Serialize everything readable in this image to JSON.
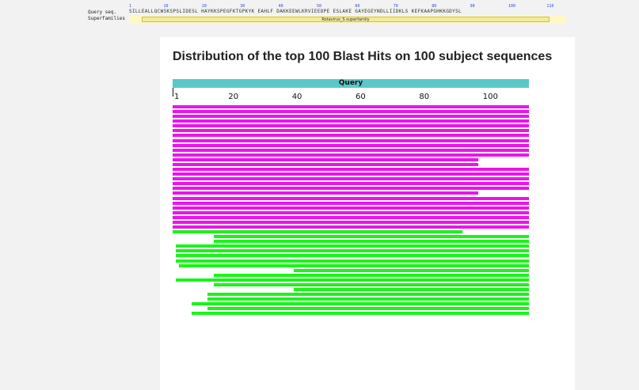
{
  "domain_strip": {
    "query_label": "Query seq.",
    "superfamilies_label": "Superfamilies",
    "ticks": [
      "1",
      "10",
      "20",
      "30",
      "40",
      "50",
      "60",
      "70",
      "80",
      "90",
      "100",
      "110"
    ],
    "sequence": "SILLEALLQCWSKSPSLIDESL HAYKKSPEGFKTGPKYK EAHLF DAKKEEWLKRVIEEDPE ESLAKE GAYEGEYNDLLIIDKLS KEFKAAPGHKKGDYSL",
    "superfamily_name": "Rotavirus_S superfamily"
  },
  "panel": {
    "title": "Distribution of the top 100 Blast Hits on 100 subject sequences",
    "query_label": "Query",
    "axis_ticks": [
      "1",
      "20",
      "40",
      "60",
      "80",
      "100"
    ]
  },
  "colors": {
    "high": "#ee12ee",
    "mid": "#19f519",
    "query": "#5bc8c8"
  },
  "chart_data": {
    "type": "alignment",
    "query_length": 112,
    "hits": [
      {
        "start": 1,
        "end": 112,
        "score": "high"
      },
      {
        "start": 1,
        "end": 112,
        "score": "high"
      },
      {
        "start": 1,
        "end": 112,
        "score": "high"
      },
      {
        "start": 1,
        "end": 112,
        "score": "high"
      },
      {
        "start": 1,
        "end": 112,
        "score": "high"
      },
      {
        "start": 1,
        "end": 112,
        "score": "high"
      },
      {
        "start": 1,
        "end": 112,
        "score": "high"
      },
      {
        "start": 1,
        "end": 112,
        "score": "high"
      },
      {
        "start": 1,
        "end": 112,
        "score": "high"
      },
      {
        "start": 1,
        "end": 112,
        "score": "high"
      },
      {
        "start": 1,
        "end": 112,
        "score": "high"
      },
      {
        "start": 1,
        "end": 96,
        "score": "high"
      },
      {
        "start": 1,
        "end": 96,
        "score": "high"
      },
      {
        "start": 1,
        "end": 112,
        "score": "high"
      },
      {
        "start": 1,
        "end": 112,
        "score": "high"
      },
      {
        "start": 1,
        "end": 112,
        "score": "high"
      },
      {
        "start": 1,
        "end": 112,
        "score": "high"
      },
      {
        "start": 1,
        "end": 112,
        "score": "high"
      },
      {
        "start": 1,
        "end": 96,
        "score": "high"
      },
      {
        "start": 1,
        "end": 112,
        "score": "high"
      },
      {
        "start": 1,
        "end": 112,
        "score": "high"
      },
      {
        "start": 1,
        "end": 112,
        "score": "high"
      },
      {
        "start": 1,
        "end": 112,
        "score": "high"
      },
      {
        "start": 1,
        "end": 112,
        "score": "high"
      },
      {
        "start": 1,
        "end": 112,
        "score": "high"
      },
      {
        "start": 1,
        "end": 112,
        "score": "high"
      },
      {
        "start": 1,
        "end": 91,
        "score": "mid"
      },
      {
        "start": 14,
        "end": 112,
        "score": "mid"
      },
      {
        "start": 14,
        "end": 112,
        "score": "mid"
      },
      {
        "start": 2,
        "end": 112,
        "score": "mid"
      },
      {
        "start": 2,
        "end": 112,
        "score": "mid"
      },
      {
        "start": 2,
        "end": 112,
        "score": "mid"
      },
      {
        "start": 2,
        "end": 112,
        "score": "mid"
      },
      {
        "start": 3,
        "end": 112,
        "score": "mid"
      },
      {
        "start": 39,
        "end": 112,
        "score": "mid"
      },
      {
        "start": 14,
        "end": 112,
        "score": "mid"
      },
      {
        "start": 2,
        "end": 112,
        "score": "mid"
      },
      {
        "start": 14,
        "end": 112,
        "score": "mid"
      },
      {
        "start": 39,
        "end": 112,
        "score": "mid"
      },
      {
        "start": 12,
        "end": 112,
        "score": "mid"
      },
      {
        "start": 12,
        "end": 112,
        "score": "mid"
      },
      {
        "start": 7,
        "end": 112,
        "score": "mid"
      },
      {
        "start": 12,
        "end": 112,
        "score": "mid"
      },
      {
        "start": 7,
        "end": 112,
        "score": "mid"
      }
    ]
  }
}
